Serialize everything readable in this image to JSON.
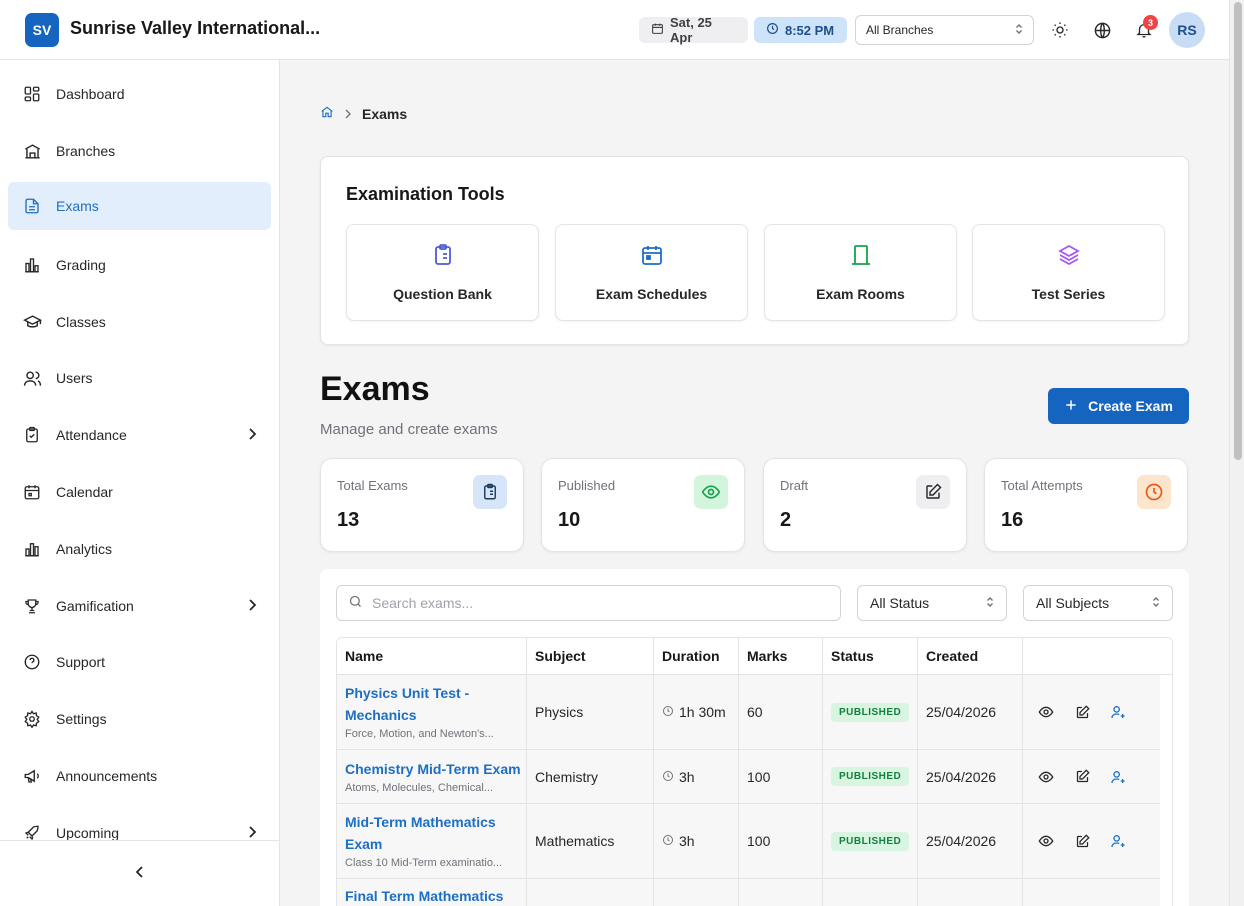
{
  "header": {
    "logo_initials": "SV",
    "app_title": "Sunrise Valley International...",
    "date": "Sat, 25 Apr",
    "time": "8:52 PM",
    "branch_select": "All Branches",
    "notifications_count": "3",
    "avatar_initials": "RS"
  },
  "sidebar": {
    "items": [
      {
        "label": "Dashboard",
        "icon": "dashboard-icon"
      },
      {
        "label": "Branches",
        "icon": "building-icon"
      },
      {
        "label": "Exams",
        "icon": "document-icon",
        "active": true
      },
      {
        "label": "Grading",
        "icon": "bar-chart-icon"
      },
      {
        "label": "Classes",
        "icon": "graduation-cap-icon"
      },
      {
        "label": "Users",
        "icon": "users-icon"
      },
      {
        "label": "Attendance",
        "icon": "clipboard-check-icon",
        "expandable": true
      },
      {
        "label": "Calendar",
        "icon": "calendar-icon"
      },
      {
        "label": "Analytics",
        "icon": "bar-chart-icon"
      },
      {
        "label": "Gamification",
        "icon": "trophy-icon",
        "expandable": true
      },
      {
        "label": "Support",
        "icon": "help-circle-icon"
      },
      {
        "label": "Settings",
        "icon": "gear-icon"
      },
      {
        "label": "Announcements",
        "icon": "megaphone-icon"
      },
      {
        "label": "Upcoming",
        "icon": "rocket-icon",
        "expandable": true
      }
    ]
  },
  "breadcrumb": {
    "current": "Exams"
  },
  "tools": {
    "title": "Examination Tools",
    "items": [
      {
        "label": "Question Bank",
        "icon": "clipboard-list-icon",
        "color": "#4f5bd5"
      },
      {
        "label": "Exam Schedules",
        "icon": "calendar-icon",
        "color": "#1d6fc4"
      },
      {
        "label": "Exam Rooms",
        "icon": "door-icon",
        "color": "#16a34a"
      },
      {
        "label": "Test Series",
        "icon": "layers-icon",
        "color": "#a855f7"
      }
    ]
  },
  "page": {
    "title": "Exams",
    "subtitle": "Manage and create exams",
    "create_button": "Create Exam"
  },
  "stats": [
    {
      "label": "Total Exams",
      "value": "13",
      "icon": "clipboard-list-icon",
      "bg": "#d6e6f8",
      "color": "#1e4f8a"
    },
    {
      "label": "Published",
      "value": "10",
      "icon": "eye-icon",
      "bg": "#d3f5dd",
      "color": "#16a34a"
    },
    {
      "label": "Draft",
      "value": "2",
      "icon": "edit-icon",
      "bg": "#efeff1",
      "color": "#27272a"
    },
    {
      "label": "Total Attempts",
      "value": "16",
      "icon": "clock-icon",
      "bg": "#fde4cc",
      "color": "#ea580c"
    }
  ],
  "filters": {
    "search_placeholder": "Search exams...",
    "status": "All Status",
    "subject": "All Subjects"
  },
  "table": {
    "columns": [
      "Name",
      "Subject",
      "Duration",
      "Marks",
      "Status",
      "Created"
    ],
    "rows": [
      {
        "name_line1": "Physics Unit Test -",
        "name_line2": "Mechanics",
        "desc": "Force, Motion, and Newton's...",
        "subject": "Physics",
        "duration": "1h 30m",
        "marks": "60",
        "status": "PUBLISHED",
        "created": "25/04/2026"
      },
      {
        "name_line1": "Chemistry Mid-Term Exam",
        "name_line2": "",
        "desc": "Atoms, Molecules, Chemical...",
        "subject": "Chemistry",
        "duration": "3h",
        "marks": "100",
        "status": "PUBLISHED",
        "created": "25/04/2026"
      },
      {
        "name_line1": "Mid-Term Mathematics",
        "name_line2": "Exam",
        "desc": "Class 10 Mid-Term examinatio...",
        "subject": "Mathematics",
        "duration": "3h",
        "marks": "100",
        "status": "PUBLISHED",
        "created": "25/04/2026"
      },
      {
        "name_line1": "Final Term Mathematics",
        "name_line2": "",
        "desc": "",
        "subject": "",
        "duration": "",
        "marks": "",
        "status": "",
        "created": ""
      }
    ]
  }
}
